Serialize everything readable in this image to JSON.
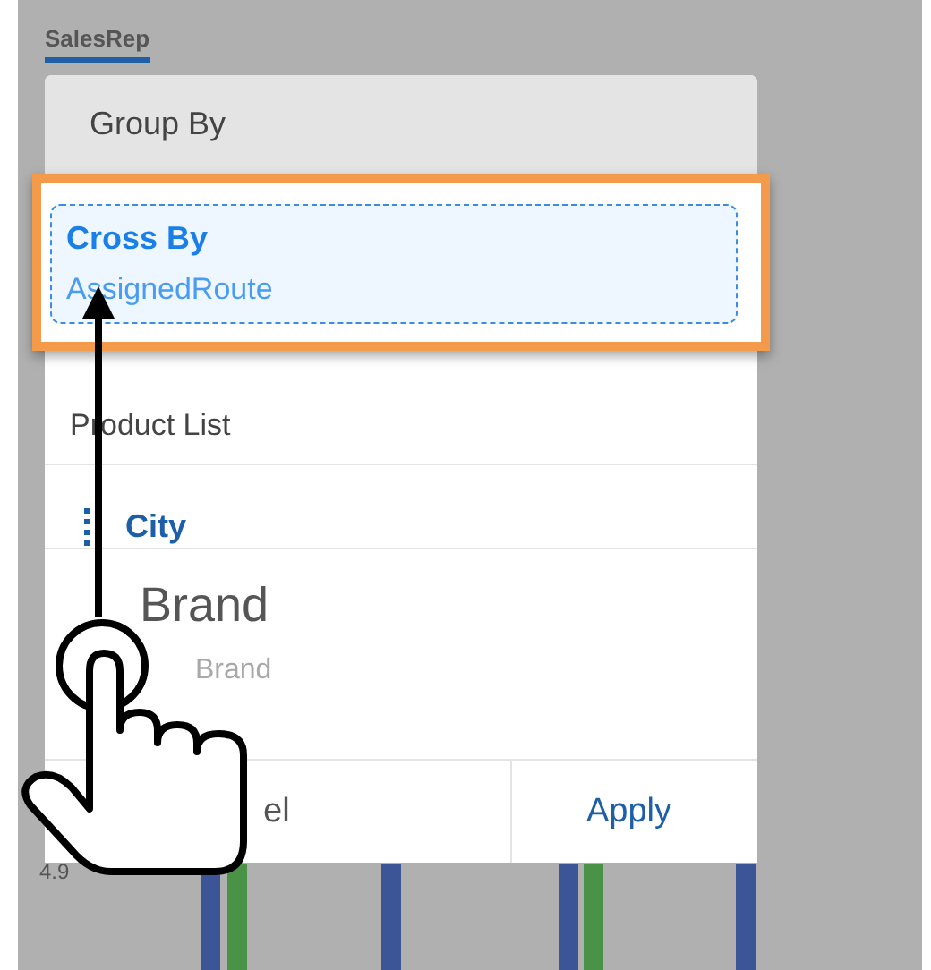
{
  "tab": {
    "label": "SalesRep",
    "selected": true
  },
  "panel": {
    "header": "Group By",
    "cross_by": {
      "title": "Cross By",
      "value": "AssignedRoute"
    },
    "section": "Product List",
    "fields": [
      {
        "label": "City",
        "kind": "item"
      },
      {
        "label": "Brand",
        "kind": "dragging"
      },
      {
        "label": "Brand",
        "kind": "ghost"
      }
    ],
    "buttons": [
      {
        "label": "el"
      },
      {
        "label": "Apply"
      }
    ]
  },
  "axis_label": "4.9"
}
